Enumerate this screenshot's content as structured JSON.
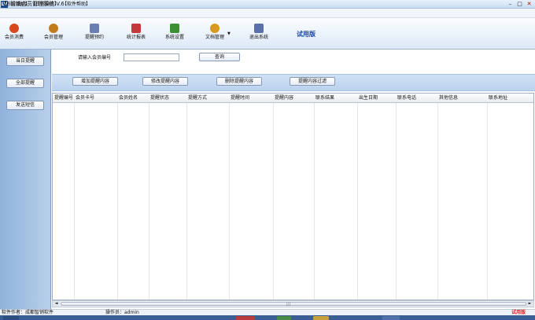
{
  "window": {
    "app_icon": "LV",
    "title": "智销会员管理系统 V.6",
    "controls": {
      "minimize": "–",
      "maximize": "□",
      "close": "✕"
    }
  },
  "menu": [
    "【系统维护】",
    "【日常操作】",
    "【软件帮助】"
  ],
  "toolbar": {
    "items": [
      {
        "label": "会员消费",
        "icon": "member-consume-icon",
        "color": "#d9481c"
      },
      {
        "label": "会员管理",
        "icon": "member-manage-icon",
        "color": "#c27b1a"
      },
      {
        "label": "提醒预约",
        "icon": "reminder-icon",
        "color": "#6a7fb0"
      },
      {
        "label": "统计报表",
        "icon": "report-icon",
        "color": "#c23a3a"
      },
      {
        "label": "系统设置",
        "icon": "settings-icon",
        "color": "#3d8f35"
      },
      {
        "label": "文档管理",
        "icon": "document-icon",
        "color": "#d89a1e"
      },
      {
        "label": "退出系统",
        "icon": "exit-icon",
        "color": "#5b6fa8"
      }
    ],
    "dropdown_arrow": "▼",
    "trial": "试用版"
  },
  "sidebar": {
    "buttons": [
      "当日提醒",
      "全部提醒",
      "发送短信"
    ]
  },
  "search": {
    "label": "请输入会员编号",
    "value": "",
    "button": "查询"
  },
  "actions": [
    "增加提醒内容",
    "修改提醒内容",
    "删除提醒内容",
    "提醒内容过滤"
  ],
  "grid": {
    "columns": [
      "提醒编号",
      "会员卡号",
      "会员姓名",
      "提醒状态",
      "提醒方式",
      "提醒时间",
      "提醒内容",
      "联系结果",
      "出生日期",
      "联系电话",
      "其他信息",
      "联系地址"
    ],
    "rows": []
  },
  "scrollbar": {
    "left": "◄",
    "right": "►",
    "grip": "|||"
  },
  "status": {
    "author": "软件作者：成都智销软件",
    "operator": "操作员：admin",
    "trial": "试用版"
  },
  "colors": {
    "accent": "#1a46a8",
    "sidebar": "#a3c0e4",
    "trial_red": "#e02020"
  }
}
